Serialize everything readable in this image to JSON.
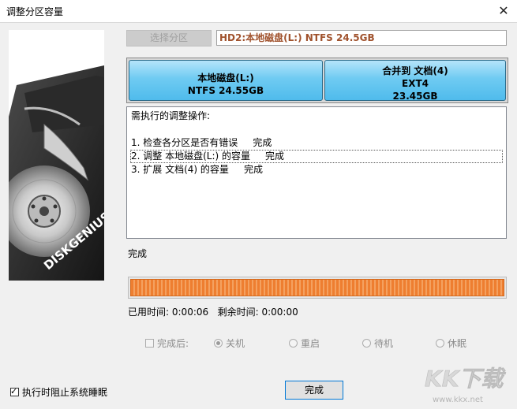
{
  "window": {
    "title": "调整分区容量",
    "close_glyph": "✕"
  },
  "side_image": {
    "brand": "DISKGENIUS"
  },
  "header": {
    "select_partition_label": "选择分区",
    "disk_path": "HD2:本地磁盘(L:) NTFS 24.5GB"
  },
  "partitions": [
    {
      "name": "本地磁盘(L:)",
      "line2": "NTFS 24.55GB",
      "line3": ""
    },
    {
      "name": "合并到 文档(4)",
      "line2": "EXT4",
      "line3": "23.45GB"
    }
  ],
  "operations": {
    "heading": "需执行的调整操作:",
    "items": [
      "1. 检查各分区是否有错误     完成",
      "2. 调整 本地磁盘(L:) 的容量     完成",
      "3. 扩展 文档(4) 的容量     完成"
    ],
    "selected_index": 1
  },
  "status": {
    "text": "完成",
    "progress": 1.0,
    "elapsed_label": "已用时间:",
    "elapsed_value": "0:00:06",
    "remaining_label": "剩余时间:",
    "remaining_value": "0:00:00"
  },
  "after_complete": {
    "label": "完成后:",
    "checked": false,
    "options": [
      "关机",
      "重启",
      "待机",
      "休眠"
    ],
    "selected": "关机"
  },
  "prevent_sleep": {
    "label": "执行时阻止系统睡眠",
    "checked": true
  },
  "ok_button_label": "完成",
  "watermark": {
    "logo_text": "KK下载",
    "url": "www.kkx.net"
  },
  "colors": {
    "partition_fill": "#6fcbf2",
    "progress_fill": "#ee7e30",
    "disk_path_text": "#a0522d"
  }
}
